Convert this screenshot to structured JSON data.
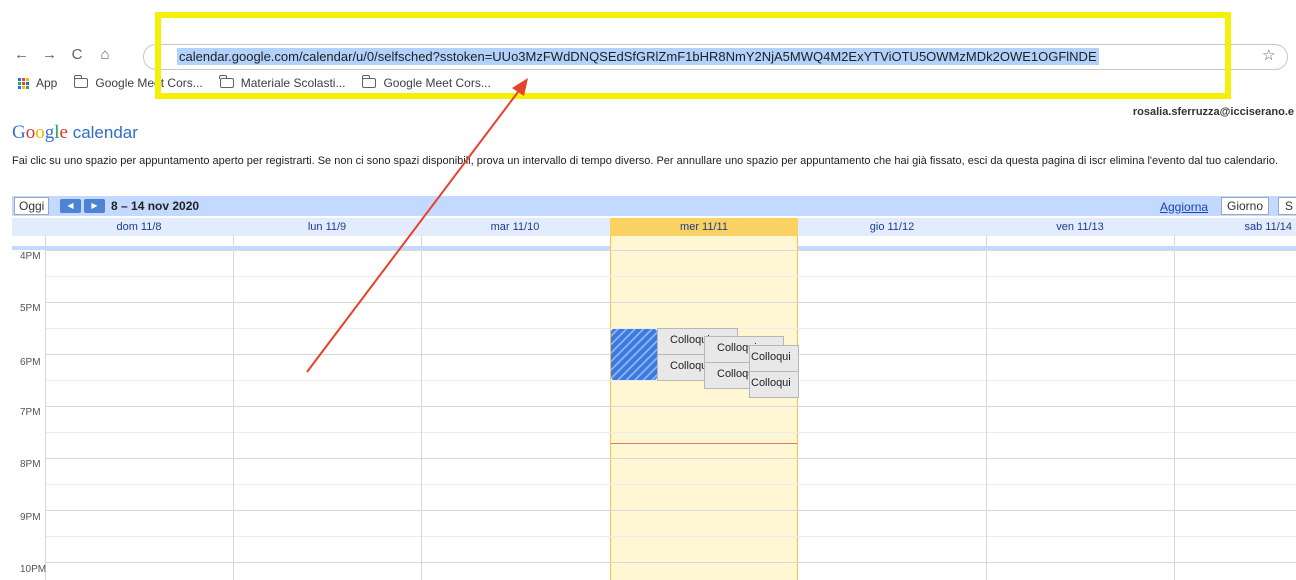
{
  "browser": {
    "nav_icons": [
      "back-arrow-icon",
      "forward-arrow-icon",
      "reload-icon",
      "home-icon"
    ],
    "nav_glyphs": {
      "back": "←",
      "forward": "→",
      "reload": "C",
      "home": "⌂"
    },
    "url": "calendar.google.com/calendar/u/0/selfsched?sstoken=UUo3MzFWdDNQSEdSfGRlZmF1bHR8NmY2NjA5MWQ4M2ExYTViOTU5OWMzMDk2OWE1OGFlNDE",
    "star_glyph": "☆",
    "bookmarks": [
      {
        "icon": "apps-grid-icon",
        "label": "App"
      },
      {
        "icon": "folder-icon",
        "label": "Google Meet Cors..."
      },
      {
        "icon": "folder-icon",
        "label": "Materiale Scolasti..."
      },
      {
        "icon": "folder-icon",
        "label": "Google Meet Cors..."
      }
    ]
  },
  "annotation": {
    "highlight_color": "#f4f108",
    "arrow_color": "#e8412c"
  },
  "calendar": {
    "user": "rosalia.sferruzza@icciserano.e",
    "logo": {
      "google": "Google",
      "calendar": "calendar"
    },
    "intro": "Fai clic su uno spazio per appuntamento aperto per registrarti. Se non ci sono spazi disponibili, prova un intervallo di tempo diverso. Per annullare uno spazio per appuntamento che hai già fissato, esci da questa pagina di iscr elimina l'evento dal tuo calendario.",
    "toolbar": {
      "today": "Oggi",
      "prev_glyph": "◀",
      "next_glyph": "▶",
      "range": "8 – 14 nov 2020",
      "refresh": "Aggiorna",
      "view_day": "Giorno",
      "view_next": "S"
    },
    "days": [
      "dom 11/8",
      "lun 11/9",
      "mar 11/10",
      "mer 11/11",
      "gio 11/12",
      "ven 11/13",
      "sab 11/14"
    ],
    "today_index": 3,
    "hours": [
      "4PM",
      "5PM",
      "6PM",
      "7PM",
      "8PM",
      "9PM",
      "10PM"
    ],
    "slot_label_a": "Colloqui",
    "slot_label_b": "Colloqui",
    "colors": {
      "toolbar": "#c3d9ff",
      "today_header": "#fad163",
      "today_column": "#fff6d4",
      "booked": "#3b7be0",
      "now_line": "#e8736b"
    }
  }
}
